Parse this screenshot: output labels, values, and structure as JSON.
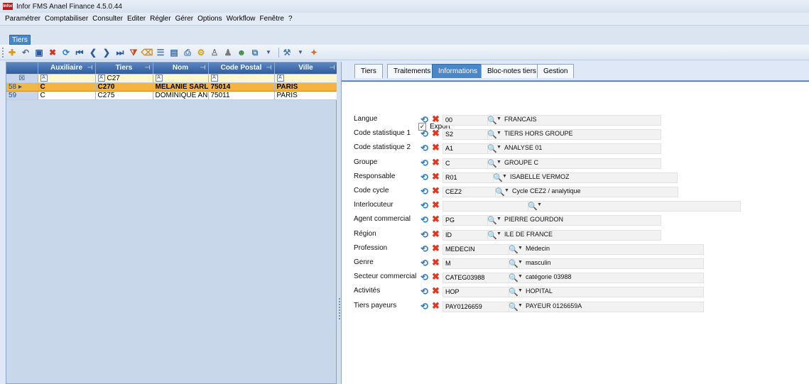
{
  "window": {
    "title": "Infor FMS Anael Finance 4.5.0.44",
    "logo": "Infor"
  },
  "menu": [
    "Paramétrer",
    "Comptabiliser",
    "Consulter",
    "Editer",
    "Régler",
    "Gérer",
    "Options",
    "Workflow",
    "Fenêtre",
    "?"
  ],
  "doc_tab": "Tiers",
  "grid": {
    "columns": [
      "Auxiliaire",
      "Tiers",
      "Nom",
      "Code Postal",
      "Ville"
    ],
    "filter": {
      "auxiliaire": "",
      "tiers": "C27",
      "nom": "",
      "code_postal": "",
      "ville": ""
    },
    "rows": [
      {
        "num": "58",
        "auxiliaire": "C",
        "tiers": "C270",
        "nom": "MELANIE SARL",
        "code_postal": "75014",
        "ville": "PARIS",
        "selected": true
      },
      {
        "num": "59",
        "auxiliaire": "C",
        "tiers": "C275",
        "nom": "DOMINIQUE AN",
        "code_postal": "75011",
        "ville": "PARIS",
        "selected": false
      }
    ]
  },
  "tabs": [
    "Tiers",
    "Traitements",
    "Informations",
    "Bloc-notes tiers",
    "Gestion"
  ],
  "active_tab": "Informations",
  "form": {
    "export_label": "Export",
    "export_checked": true,
    "fields": [
      {
        "label": "Langue",
        "code": "00",
        "desc": "FRANCAIS"
      },
      {
        "label": "Code statistique 1",
        "code": "S2",
        "desc": "TIERS HORS GROUPE"
      },
      {
        "label": "Code statistique 2",
        "code": "A1",
        "desc": "ANALYSE 01"
      },
      {
        "label": "Groupe",
        "code": "C",
        "desc": "GROUPE C"
      },
      {
        "label": "Responsable",
        "code": "R01",
        "desc": "ISABELLE VERMOZ"
      },
      {
        "label": "Code cycle",
        "code": "CEZ2",
        "desc": "Cycle CEZ2 / analytique"
      },
      {
        "label": "Interlocuteur",
        "code": "",
        "desc": ""
      },
      {
        "label": "Agent commercial",
        "code": "PG",
        "desc": "PIERRE GOURDON"
      },
      {
        "label": "Région",
        "code": "ID",
        "desc": "ILE DE FRANCE"
      },
      {
        "label": "Profession",
        "code": "MEDECIN",
        "desc": "Médecin"
      },
      {
        "label": "Genre",
        "code": "M",
        "desc": "masculin"
      },
      {
        "label": "Secteur commercial",
        "code": "CATEG03988",
        "desc": "catégorie 03988"
      },
      {
        "label": "Activités",
        "code": "HOP",
        "desc": "HOPITAL"
      },
      {
        "label": "Tiers payeurs",
        "code": "PAY0126659",
        "desc": "PAYEUR 0126659A"
      }
    ]
  },
  "colors": {
    "accent": "#4a87c9",
    "selected_row": "#f6b33d",
    "header": "#2e5c9e"
  }
}
